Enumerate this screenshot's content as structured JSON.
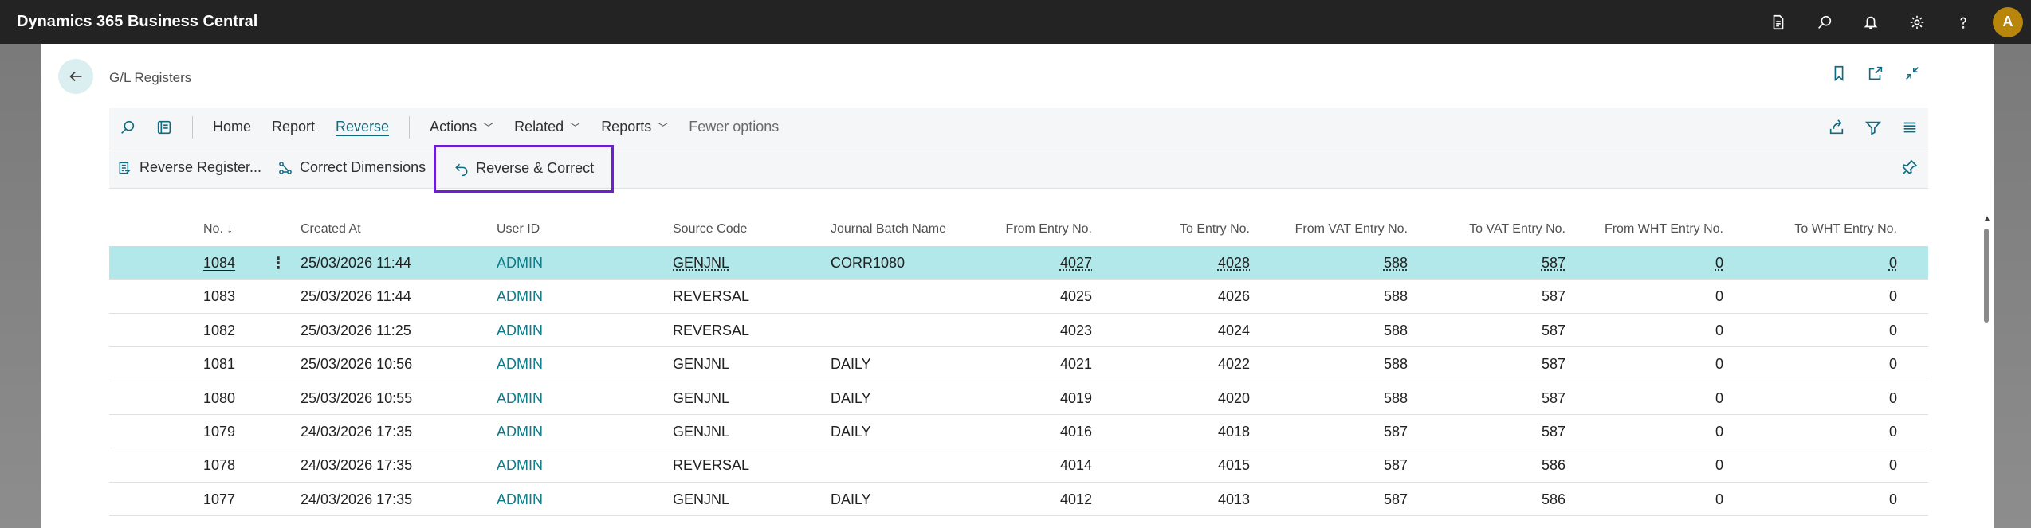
{
  "app": {
    "title": "Dynamics 365 Business Central",
    "avatar_initial": "A"
  },
  "topbar_icons": [
    "document-icon",
    "search-icon",
    "bell-icon",
    "gear-icon",
    "help-icon"
  ],
  "page": {
    "title": "G/L Registers"
  },
  "tabs": {
    "home": "Home",
    "report": "Report",
    "reverse": "Reverse",
    "actions": "Actions",
    "related": "Related",
    "reports": "Reports",
    "fewer": "Fewer options"
  },
  "commands": {
    "reverse_register": "Reverse Register...",
    "correct_dimensions": "Correct Dimensions",
    "reverse_correct": "Reverse & Correct"
  },
  "columns": {
    "no": "No.",
    "sort_arrow": "↓",
    "created_at": "Created At",
    "user_id": "User ID",
    "source_code": "Source Code",
    "journal_batch": "Journal Batch Name",
    "from_entry": "From Entry No.",
    "to_entry": "To Entry No.",
    "from_vat": "From VAT Entry No.",
    "to_vat": "To VAT Entry No.",
    "from_wht": "From WHT Entry No.",
    "to_wht": "To WHT Entry No."
  },
  "rows": [
    {
      "no": "1084",
      "created_at": "25/03/2026 11:44",
      "user_id": "ADMIN",
      "source_code": "GENJNL",
      "journal_batch": "CORR1080",
      "from_entry": "4027",
      "to_entry": "4028",
      "from_vat": "588",
      "to_vat": "587",
      "from_wht": "0",
      "to_wht": "0"
    },
    {
      "no": "1083",
      "created_at": "25/03/2026 11:44",
      "user_id": "ADMIN",
      "source_code": "REVERSAL",
      "journal_batch": "",
      "from_entry": "4025",
      "to_entry": "4026",
      "from_vat": "588",
      "to_vat": "587",
      "from_wht": "0",
      "to_wht": "0"
    },
    {
      "no": "1082",
      "created_at": "25/03/2026 11:25",
      "user_id": "ADMIN",
      "source_code": "REVERSAL",
      "journal_batch": "",
      "from_entry": "4023",
      "to_entry": "4024",
      "from_vat": "588",
      "to_vat": "587",
      "from_wht": "0",
      "to_wht": "0"
    },
    {
      "no": "1081",
      "created_at": "25/03/2026 10:56",
      "user_id": "ADMIN",
      "source_code": "GENJNL",
      "journal_batch": "DAILY",
      "from_entry": "4021",
      "to_entry": "4022",
      "from_vat": "588",
      "to_vat": "587",
      "from_wht": "0",
      "to_wht": "0"
    },
    {
      "no": "1080",
      "created_at": "25/03/2026 10:55",
      "user_id": "ADMIN",
      "source_code": "GENJNL",
      "journal_batch": "DAILY",
      "from_entry": "4019",
      "to_entry": "4020",
      "from_vat": "588",
      "to_vat": "587",
      "from_wht": "0",
      "to_wht": "0"
    },
    {
      "no": "1079",
      "created_at": "24/03/2026 17:35",
      "user_id": "ADMIN",
      "source_code": "GENJNL",
      "journal_batch": "DAILY",
      "from_entry": "4016",
      "to_entry": "4018",
      "from_vat": "587",
      "to_vat": "587",
      "from_wht": "0",
      "to_wht": "0"
    },
    {
      "no": "1078",
      "created_at": "24/03/2026 17:35",
      "user_id": "ADMIN",
      "source_code": "REVERSAL",
      "journal_batch": "",
      "from_entry": "4014",
      "to_entry": "4015",
      "from_vat": "587",
      "to_vat": "586",
      "from_wht": "0",
      "to_wht": "0"
    },
    {
      "no": "1077",
      "created_at": "24/03/2026 17:35",
      "user_id": "ADMIN",
      "source_code": "GENJNL",
      "journal_batch": "DAILY",
      "from_entry": "4012",
      "to_entry": "4013",
      "from_vat": "587",
      "to_vat": "586",
      "from_wht": "0",
      "to_wht": "0"
    }
  ],
  "colors": {
    "accent": "#0f6b80",
    "selected_row": "#b2e8ea",
    "highlight_border": "#6a1fd1",
    "topbar": "#232323"
  }
}
